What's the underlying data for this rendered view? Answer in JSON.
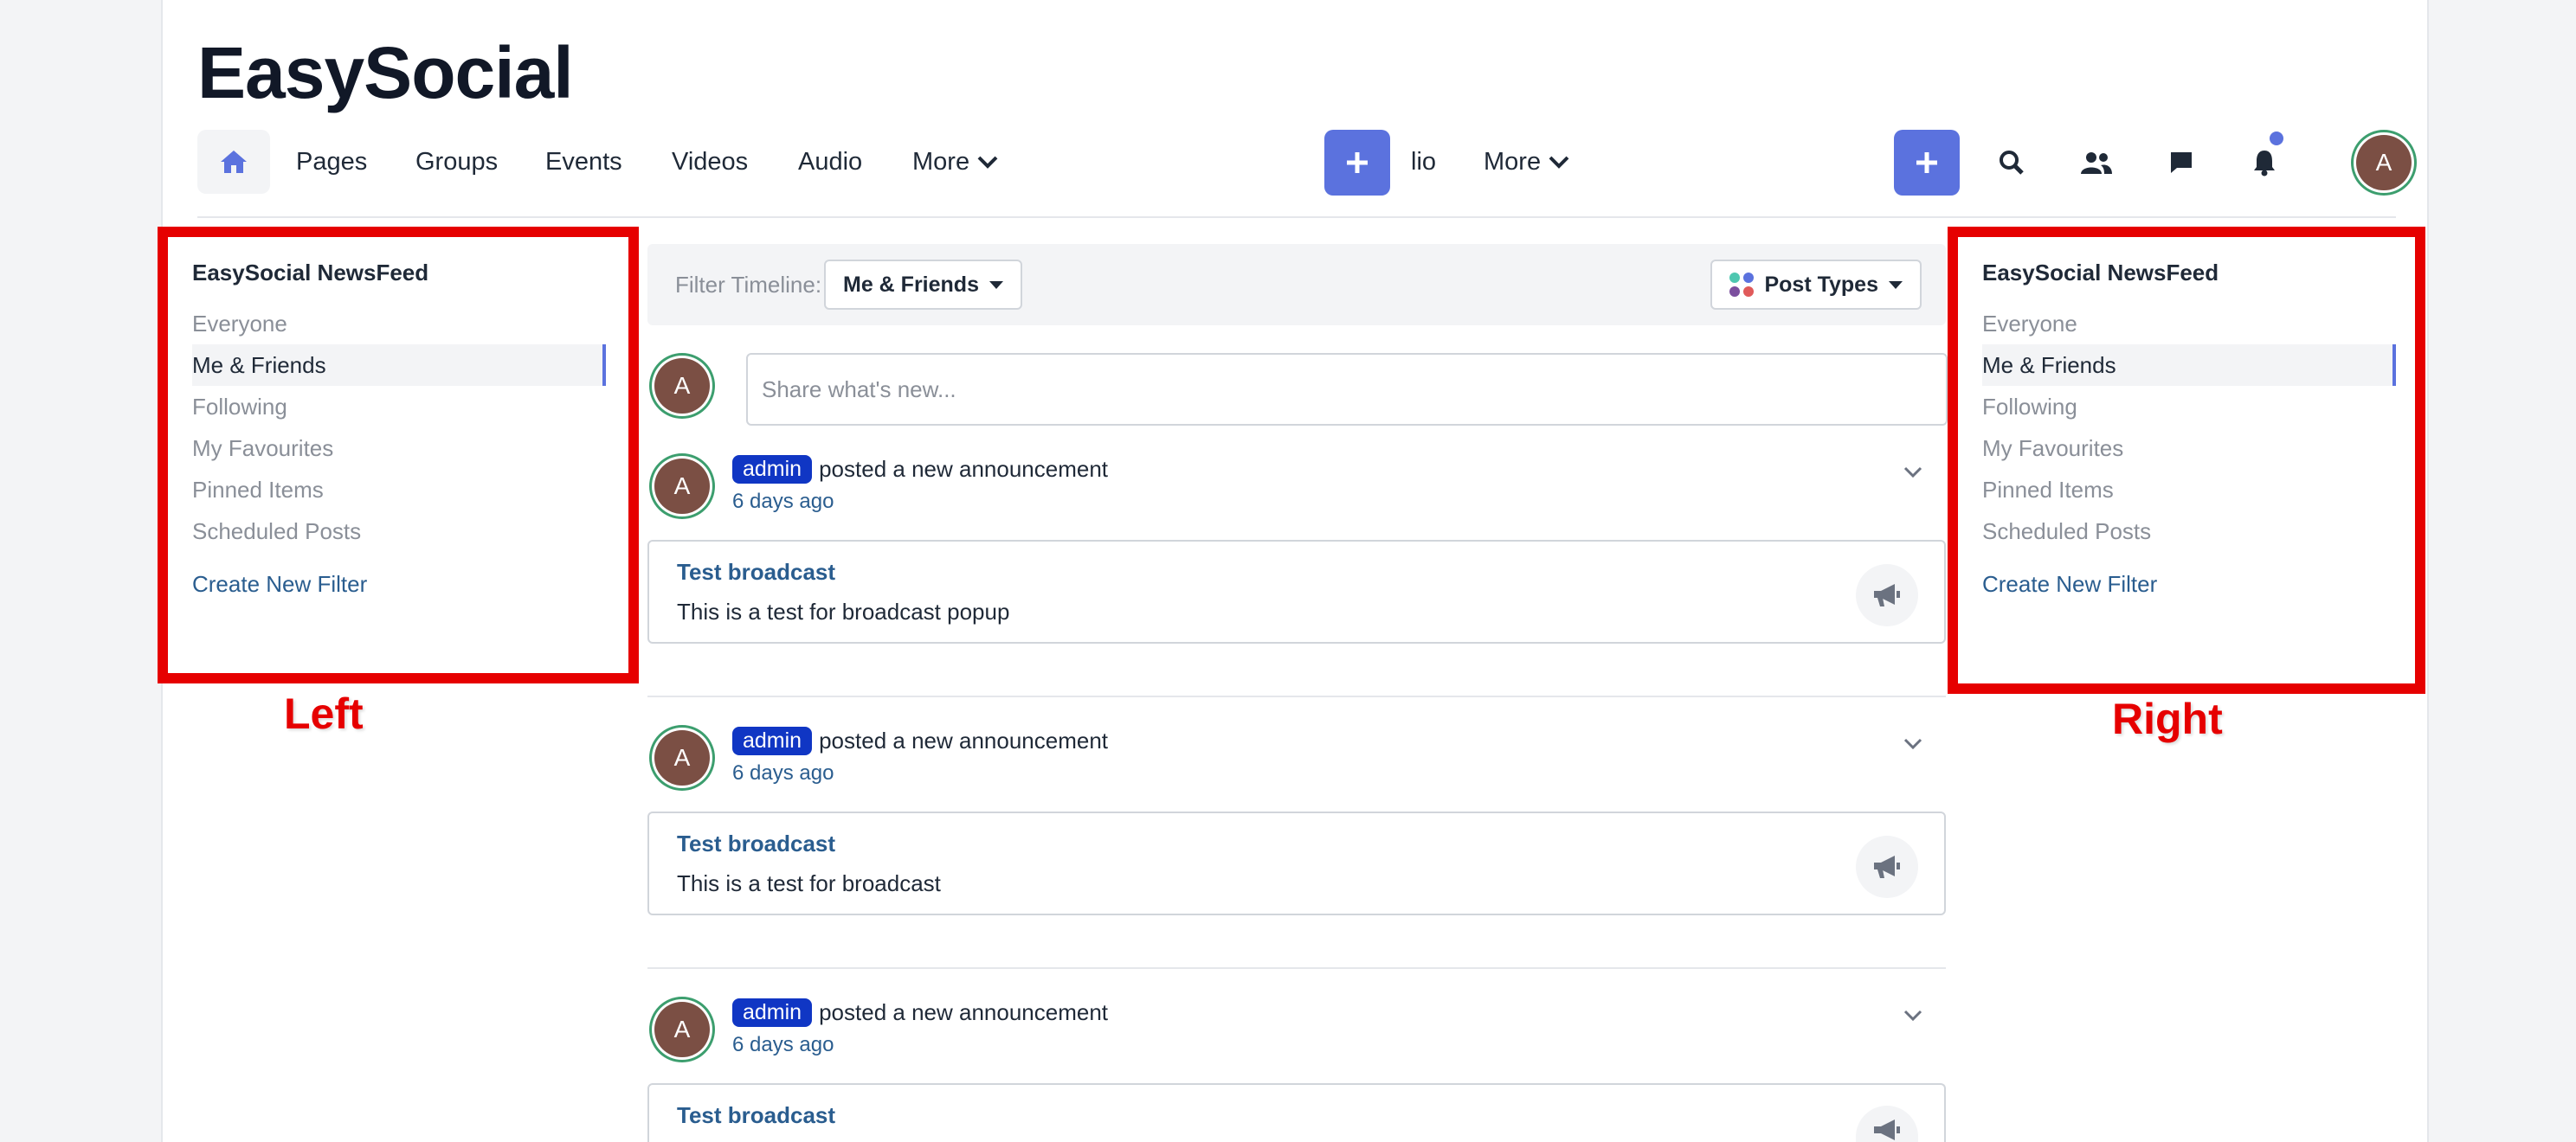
{
  "brand": "EasySocial",
  "nav": {
    "links": [
      "Pages",
      "Groups",
      "Events",
      "Videos",
      "Audio",
      "More"
    ],
    "middle_link": "lio",
    "middle_more": "More"
  },
  "sidebar_left": {
    "title": "EasySocial NewsFeed",
    "items": [
      "Everyone",
      "Me & Friends",
      "Following",
      "My Favourites",
      "Pinned Items",
      "Scheduled Posts"
    ],
    "active_item": "Me & Friends",
    "create_filter": "Create New Filter"
  },
  "sidebar_right": {
    "title": "EasySocial NewsFeed",
    "items": [
      "Everyone",
      "Me & Friends",
      "Following",
      "My Favourites",
      "Pinned Items",
      "Scheduled Posts"
    ],
    "active_item": "Me & Friends",
    "create_filter": "Create New Filter"
  },
  "annotations": {
    "left": "Left",
    "right": "Right"
  },
  "filter": {
    "label": "Filter Timeline:",
    "selected": "Me & Friends",
    "post_types": "Post Types"
  },
  "composer": {
    "placeholder": "Share what's new...",
    "avatar": "A"
  },
  "user_avatar": "A",
  "posts": [
    {
      "author": "admin",
      "action": "posted a new announcement",
      "time": "6 days ago",
      "title": "Test broadcast",
      "text": "This is a test for broadcast popup",
      "avatar": "A"
    },
    {
      "author": "admin",
      "action": "posted a new announcement",
      "time": "6 days ago",
      "title": "Test broadcast",
      "text": "This is a test for broadcast",
      "avatar": "A"
    },
    {
      "author": "admin",
      "action": "posted a new announcement",
      "time": "6 days ago",
      "title": "Test broadcast",
      "text": "",
      "avatar": "A"
    }
  ],
  "colors": {
    "accent": "#5b72de",
    "badge": "#1036c4",
    "annotation": "#e60000",
    "avatar_ring": "#3c9e6e",
    "avatar_bg": "#7b4f44"
  },
  "icons": {
    "home": "home-icon",
    "plus": "plus-icon",
    "search": "search-icon",
    "friends": "users-icon",
    "messages": "chat-icon",
    "notifications": "bell-icon",
    "chevron": "chevron-down-icon",
    "announcement": "megaphone-icon"
  }
}
